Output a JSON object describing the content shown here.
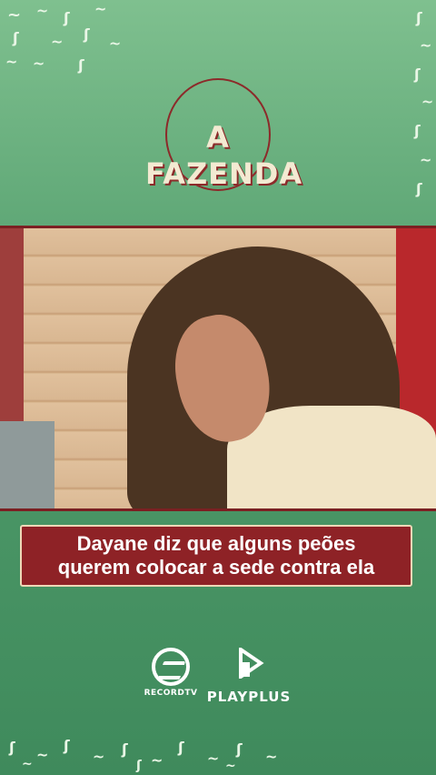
{
  "show": {
    "logo_text": "A FAZENDA"
  },
  "caption": {
    "text": "Dayane diz que alguns peões\nquerem colocar a sede contra ela"
  },
  "brands": [
    {
      "name": "RECORDTV",
      "icon": "record-logo-icon"
    },
    {
      "name": "PLAYPLUS",
      "icon": "playplus-logo-icon"
    }
  ],
  "colors": {
    "background": "#4f9b6a",
    "accent": "#8e2226",
    "border": "#7b1f22",
    "text": "#ffffff"
  }
}
